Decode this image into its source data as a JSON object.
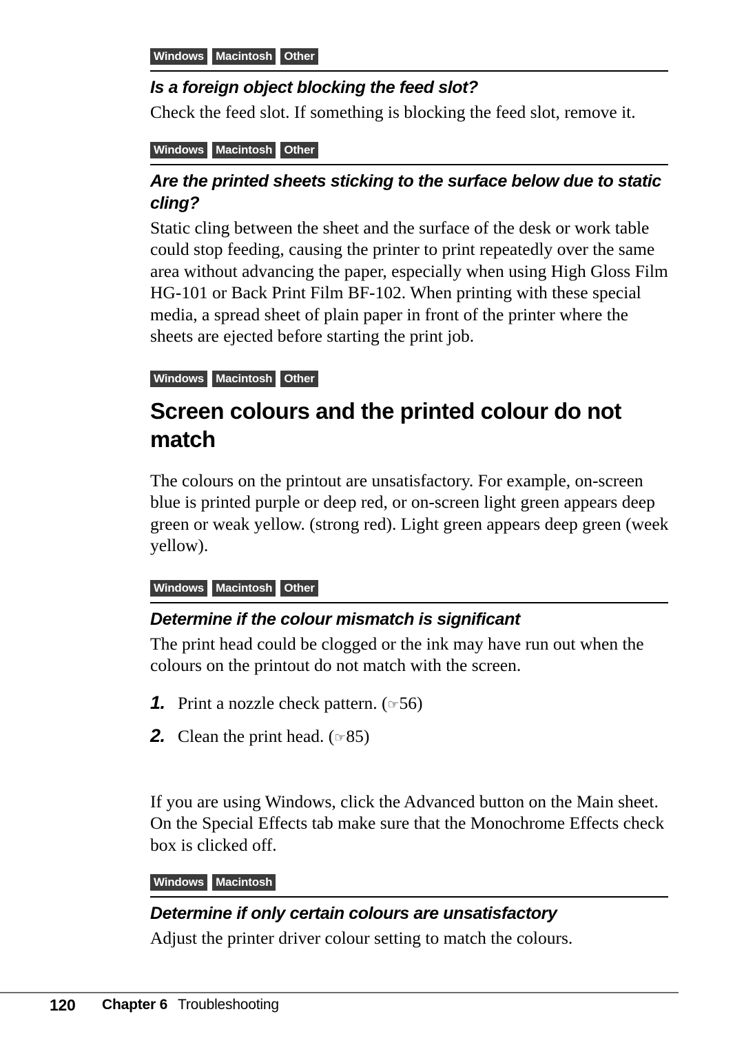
{
  "document": {
    "page_number": "120",
    "chapter": "Chapter 6",
    "chapter_title": "Troubleshooting"
  },
  "platform_labels": {
    "windows": "Windows",
    "macintosh": "Macintosh",
    "other": "Other"
  },
  "sections": [
    {
      "badges": [
        "Windows",
        "Macintosh",
        "Other"
      ],
      "heading": "Is a foreign object blocking the feed slot?",
      "body": "Check the feed slot. If something is blocking the feed slot, remove it."
    },
    {
      "badges": [
        "Windows",
        "Macintosh",
        "Other"
      ],
      "heading": "Are the printed sheets sticking to the surface below due to static cling?",
      "body": "Static cling between the sheet and the surface of the desk or work table could stop feeding, causing the printer to print repeatedly over the same area without advancing the paper, especially when using High Gloss Film HG-101 or Back Print Film BF-102. When printing with these special media, a spread sheet of plain paper in front of the printer where the sheets are ejected before starting the print job."
    },
    {
      "badges": [
        "Windows",
        "Macintosh",
        "Other"
      ],
      "heading": "Screen colours and the printed colour do not match",
      "body": "The colours on the printout are unsatisfactory.  For example, on-screen blue is printed purple or deep red, or on-screen light green appears deep green or weak yellow. (strong red).  Light green appears deep green (week yellow)."
    },
    {
      "badges": [
        "Windows",
        "Macintosh",
        "Other"
      ],
      "heading": "Determine if the colour mismatch is significant",
      "body": "The print head could be clogged or the ink may have run out when the colours on the printout do not match with the screen.",
      "steps": [
        {
          "number": "1.",
          "text": "Print a nozzle check pattern. (",
          "ref_icon": "☞",
          "ref_page": "56",
          "close": ")"
        },
        {
          "number": "2.",
          "text": "Clean the print head. (",
          "ref_icon": "☞",
          "ref_page": "85",
          "close": ")"
        }
      ],
      "body2": "If you are using Windows, click the Advanced button on the Main sheet. On the Special Effects tab make sure that the Monochrome Effects check box is clicked off."
    },
    {
      "badges": [
        "Windows",
        "Macintosh"
      ],
      "heading": "Determine if only certain colours are unsatisfactory",
      "body": "Adjust the printer driver colour setting to match the colours."
    }
  ],
  "colors": {
    "badge_background": "#3b3b3b",
    "badge_text": "#ffffff",
    "rule": "#000000",
    "footer_rule": "#6b6b6b",
    "text": "#000000",
    "page_background": "#ffffff"
  }
}
